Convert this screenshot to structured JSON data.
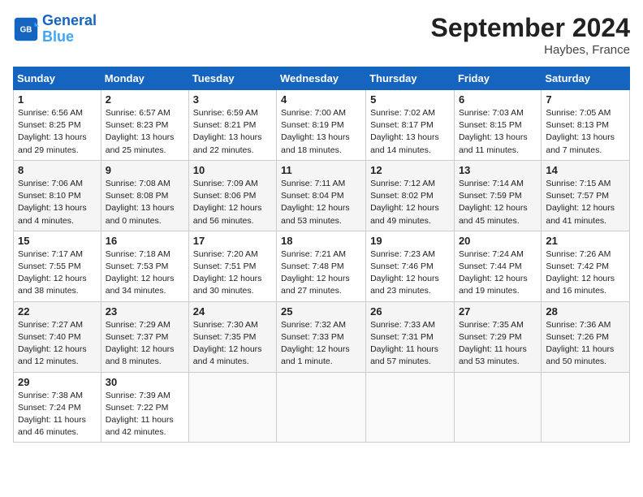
{
  "header": {
    "logo_line1": "General",
    "logo_line2": "Blue",
    "month": "September 2024",
    "location": "Haybes, France"
  },
  "days_of_week": [
    "Sunday",
    "Monday",
    "Tuesday",
    "Wednesday",
    "Thursday",
    "Friday",
    "Saturday"
  ],
  "weeks": [
    [
      {
        "day": 1,
        "info": "Sunrise: 6:56 AM\nSunset: 8:25 PM\nDaylight: 13 hours\nand 29 minutes."
      },
      {
        "day": 2,
        "info": "Sunrise: 6:57 AM\nSunset: 8:23 PM\nDaylight: 13 hours\nand 25 minutes."
      },
      {
        "day": 3,
        "info": "Sunrise: 6:59 AM\nSunset: 8:21 PM\nDaylight: 13 hours\nand 22 minutes."
      },
      {
        "day": 4,
        "info": "Sunrise: 7:00 AM\nSunset: 8:19 PM\nDaylight: 13 hours\nand 18 minutes."
      },
      {
        "day": 5,
        "info": "Sunrise: 7:02 AM\nSunset: 8:17 PM\nDaylight: 13 hours\nand 14 minutes."
      },
      {
        "day": 6,
        "info": "Sunrise: 7:03 AM\nSunset: 8:15 PM\nDaylight: 13 hours\nand 11 minutes."
      },
      {
        "day": 7,
        "info": "Sunrise: 7:05 AM\nSunset: 8:13 PM\nDaylight: 13 hours\nand 7 minutes."
      }
    ],
    [
      {
        "day": 8,
        "info": "Sunrise: 7:06 AM\nSunset: 8:10 PM\nDaylight: 13 hours\nand 4 minutes."
      },
      {
        "day": 9,
        "info": "Sunrise: 7:08 AM\nSunset: 8:08 PM\nDaylight: 13 hours\nand 0 minutes."
      },
      {
        "day": 10,
        "info": "Sunrise: 7:09 AM\nSunset: 8:06 PM\nDaylight: 12 hours\nand 56 minutes."
      },
      {
        "day": 11,
        "info": "Sunrise: 7:11 AM\nSunset: 8:04 PM\nDaylight: 12 hours\nand 53 minutes."
      },
      {
        "day": 12,
        "info": "Sunrise: 7:12 AM\nSunset: 8:02 PM\nDaylight: 12 hours\nand 49 minutes."
      },
      {
        "day": 13,
        "info": "Sunrise: 7:14 AM\nSunset: 7:59 PM\nDaylight: 12 hours\nand 45 minutes."
      },
      {
        "day": 14,
        "info": "Sunrise: 7:15 AM\nSunset: 7:57 PM\nDaylight: 12 hours\nand 41 minutes."
      }
    ],
    [
      {
        "day": 15,
        "info": "Sunrise: 7:17 AM\nSunset: 7:55 PM\nDaylight: 12 hours\nand 38 minutes."
      },
      {
        "day": 16,
        "info": "Sunrise: 7:18 AM\nSunset: 7:53 PM\nDaylight: 12 hours\nand 34 minutes."
      },
      {
        "day": 17,
        "info": "Sunrise: 7:20 AM\nSunset: 7:51 PM\nDaylight: 12 hours\nand 30 minutes."
      },
      {
        "day": 18,
        "info": "Sunrise: 7:21 AM\nSunset: 7:48 PM\nDaylight: 12 hours\nand 27 minutes."
      },
      {
        "day": 19,
        "info": "Sunrise: 7:23 AM\nSunset: 7:46 PM\nDaylight: 12 hours\nand 23 minutes."
      },
      {
        "day": 20,
        "info": "Sunrise: 7:24 AM\nSunset: 7:44 PM\nDaylight: 12 hours\nand 19 minutes."
      },
      {
        "day": 21,
        "info": "Sunrise: 7:26 AM\nSunset: 7:42 PM\nDaylight: 12 hours\nand 16 minutes."
      }
    ],
    [
      {
        "day": 22,
        "info": "Sunrise: 7:27 AM\nSunset: 7:40 PM\nDaylight: 12 hours\nand 12 minutes."
      },
      {
        "day": 23,
        "info": "Sunrise: 7:29 AM\nSunset: 7:37 PM\nDaylight: 12 hours\nand 8 minutes."
      },
      {
        "day": 24,
        "info": "Sunrise: 7:30 AM\nSunset: 7:35 PM\nDaylight: 12 hours\nand 4 minutes."
      },
      {
        "day": 25,
        "info": "Sunrise: 7:32 AM\nSunset: 7:33 PM\nDaylight: 12 hours\nand 1 minute."
      },
      {
        "day": 26,
        "info": "Sunrise: 7:33 AM\nSunset: 7:31 PM\nDaylight: 11 hours\nand 57 minutes."
      },
      {
        "day": 27,
        "info": "Sunrise: 7:35 AM\nSunset: 7:29 PM\nDaylight: 11 hours\nand 53 minutes."
      },
      {
        "day": 28,
        "info": "Sunrise: 7:36 AM\nSunset: 7:26 PM\nDaylight: 11 hours\nand 50 minutes."
      }
    ],
    [
      {
        "day": 29,
        "info": "Sunrise: 7:38 AM\nSunset: 7:24 PM\nDaylight: 11 hours\nand 46 minutes."
      },
      {
        "day": 30,
        "info": "Sunrise: 7:39 AM\nSunset: 7:22 PM\nDaylight: 11 hours\nand 42 minutes."
      },
      null,
      null,
      null,
      null,
      null
    ]
  ]
}
